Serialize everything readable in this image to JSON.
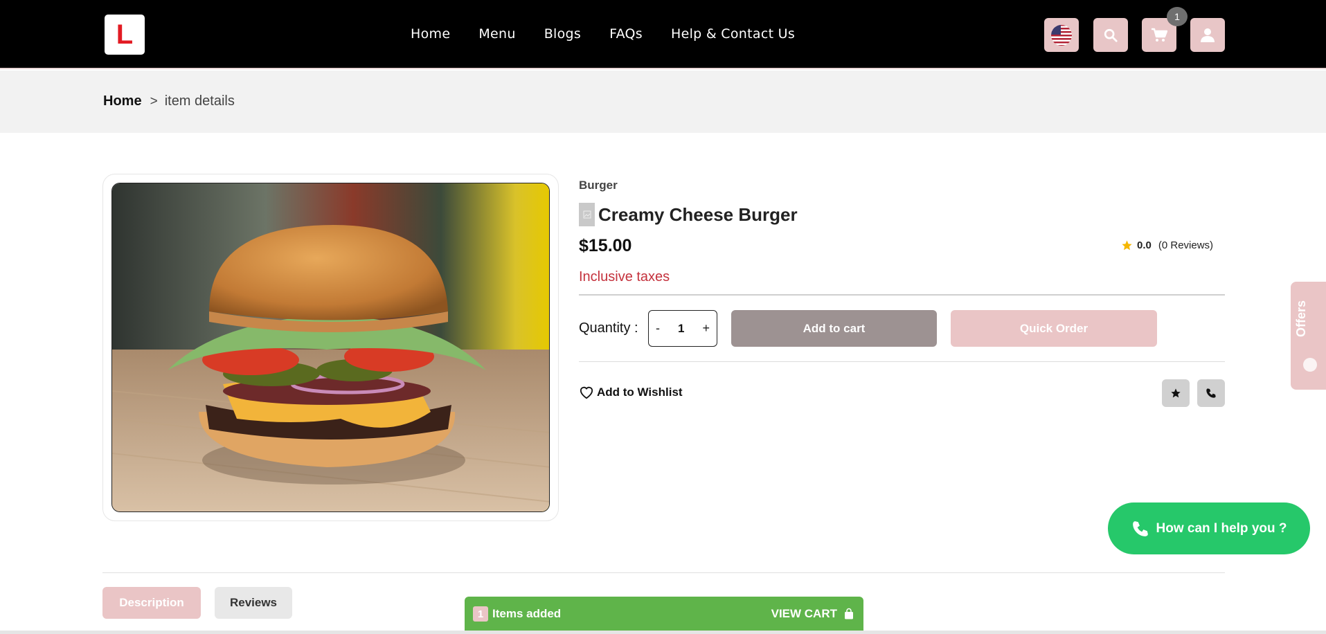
{
  "header": {
    "logo_letter": "L",
    "nav": [
      "Home",
      "Menu",
      "Blogs",
      "FAQs",
      "Help & Contact Us"
    ],
    "cart_count": "1",
    "accent_color": "#e8c6c7"
  },
  "breadcrumb": {
    "home": "Home",
    "separator": ">",
    "current": "item details"
  },
  "product": {
    "category": "Burger",
    "title": "Creamy Cheese Burger",
    "price": "$15.00",
    "rating": "0.0",
    "reviews": "(0 Reviews)",
    "tax_note": "Inclusive taxes",
    "quantity_label": "Quantity :",
    "quantity": "1",
    "minus": "-",
    "plus": "+",
    "add_to_cart": "Add to cart",
    "quick_order": "Quick Order",
    "wishlist": "Add to Wishlist"
  },
  "offers_tab": "Offers",
  "help_bubble": "How can I help you ?",
  "tabs": {
    "description": "Description",
    "reviews": "Reviews"
  },
  "cart_bar": {
    "count": "1",
    "label": "Items added",
    "view_cart": "VIEW CART"
  }
}
